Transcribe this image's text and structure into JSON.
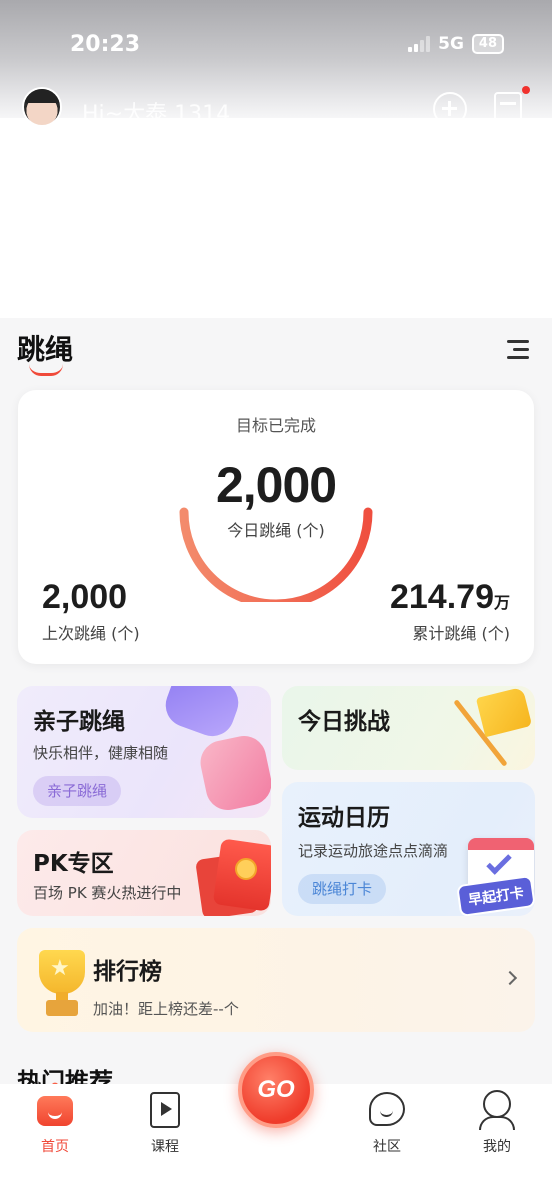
{
  "status_bar": {
    "time": "20:23",
    "network": "5G",
    "battery": "48"
  },
  "header": {
    "greeting": "Hi~大泰 1314"
  },
  "section": {
    "title": "跳绳"
  },
  "stats": {
    "goal_status": "目标已完成",
    "today_count": "2,000",
    "today_label": "今日跳绳 (个)",
    "today_progress": 1.0,
    "last_count": "2,000",
    "last_label": "上次跳绳 (个)",
    "total_count": "214.79",
    "total_unit": "万",
    "total_label": "累计跳绳 (个)"
  },
  "cards": {
    "parent": {
      "title": "亲子跳绳",
      "subtitle": "快乐相伴，健康相随",
      "chip": "亲子跳绳"
    },
    "challenge": {
      "title": "今日挑战"
    },
    "calendar": {
      "title": "运动日历",
      "subtitle": "记录运动旅途点点滴滴",
      "chip": "跳绳打卡",
      "badge": "早起打卡"
    },
    "pk": {
      "title": "PK专区",
      "subtitle": "百场 PK 赛火热进行中"
    },
    "rank": {
      "title": "排行榜",
      "subtitle": "加油！距上榜还差--个"
    }
  },
  "hot": {
    "title": "热门推荐"
  },
  "tabbar": {
    "home": "首页",
    "course": "课程",
    "go": "GO",
    "community": "社区",
    "mine": "我的"
  },
  "colors": {
    "accent": "#f04a3a",
    "arc_start": "#f38b6c",
    "arc_end": "#ef4f3f"
  }
}
